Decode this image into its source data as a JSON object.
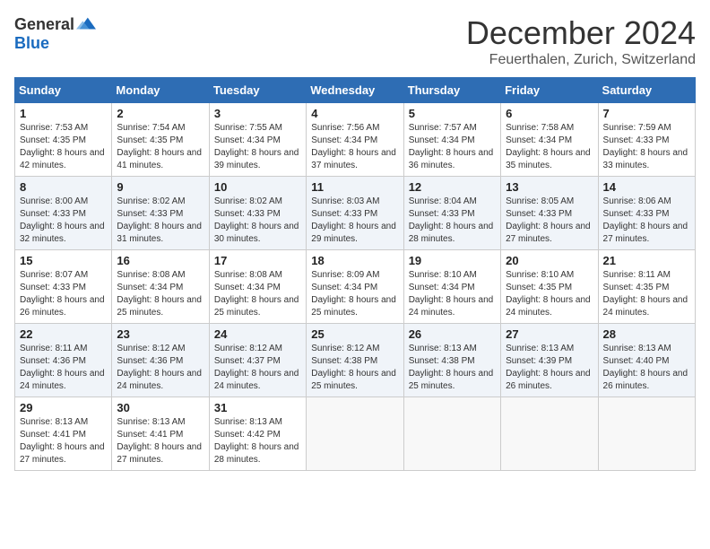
{
  "header": {
    "logo_general": "General",
    "logo_blue": "Blue",
    "month": "December 2024",
    "location": "Feuerthalen, Zurich, Switzerland"
  },
  "days_of_week": [
    "Sunday",
    "Monday",
    "Tuesday",
    "Wednesday",
    "Thursday",
    "Friday",
    "Saturday"
  ],
  "weeks": [
    [
      {
        "day": "1",
        "sunrise": "7:53 AM",
        "sunset": "4:35 PM",
        "daylight": "8 hours and 42 minutes."
      },
      {
        "day": "2",
        "sunrise": "7:54 AM",
        "sunset": "4:35 PM",
        "daylight": "8 hours and 41 minutes."
      },
      {
        "day": "3",
        "sunrise": "7:55 AM",
        "sunset": "4:34 PM",
        "daylight": "8 hours and 39 minutes."
      },
      {
        "day": "4",
        "sunrise": "7:56 AM",
        "sunset": "4:34 PM",
        "daylight": "8 hours and 37 minutes."
      },
      {
        "day": "5",
        "sunrise": "7:57 AM",
        "sunset": "4:34 PM",
        "daylight": "8 hours and 36 minutes."
      },
      {
        "day": "6",
        "sunrise": "7:58 AM",
        "sunset": "4:34 PM",
        "daylight": "8 hours and 35 minutes."
      },
      {
        "day": "7",
        "sunrise": "7:59 AM",
        "sunset": "4:33 PM",
        "daylight": "8 hours and 33 minutes."
      }
    ],
    [
      {
        "day": "8",
        "sunrise": "8:00 AM",
        "sunset": "4:33 PM",
        "daylight": "8 hours and 32 minutes."
      },
      {
        "day": "9",
        "sunrise": "8:02 AM",
        "sunset": "4:33 PM",
        "daylight": "8 hours and 31 minutes."
      },
      {
        "day": "10",
        "sunrise": "8:02 AM",
        "sunset": "4:33 PM",
        "daylight": "8 hours and 30 minutes."
      },
      {
        "day": "11",
        "sunrise": "8:03 AM",
        "sunset": "4:33 PM",
        "daylight": "8 hours and 29 minutes."
      },
      {
        "day": "12",
        "sunrise": "8:04 AM",
        "sunset": "4:33 PM",
        "daylight": "8 hours and 28 minutes."
      },
      {
        "day": "13",
        "sunrise": "8:05 AM",
        "sunset": "4:33 PM",
        "daylight": "8 hours and 27 minutes."
      },
      {
        "day": "14",
        "sunrise": "8:06 AM",
        "sunset": "4:33 PM",
        "daylight": "8 hours and 27 minutes."
      }
    ],
    [
      {
        "day": "15",
        "sunrise": "8:07 AM",
        "sunset": "4:33 PM",
        "daylight": "8 hours and 26 minutes."
      },
      {
        "day": "16",
        "sunrise": "8:08 AM",
        "sunset": "4:34 PM",
        "daylight": "8 hours and 25 minutes."
      },
      {
        "day": "17",
        "sunrise": "8:08 AM",
        "sunset": "4:34 PM",
        "daylight": "8 hours and 25 minutes."
      },
      {
        "day": "18",
        "sunrise": "8:09 AM",
        "sunset": "4:34 PM",
        "daylight": "8 hours and 25 minutes."
      },
      {
        "day": "19",
        "sunrise": "8:10 AM",
        "sunset": "4:34 PM",
        "daylight": "8 hours and 24 minutes."
      },
      {
        "day": "20",
        "sunrise": "8:10 AM",
        "sunset": "4:35 PM",
        "daylight": "8 hours and 24 minutes."
      },
      {
        "day": "21",
        "sunrise": "8:11 AM",
        "sunset": "4:35 PM",
        "daylight": "8 hours and 24 minutes."
      }
    ],
    [
      {
        "day": "22",
        "sunrise": "8:11 AM",
        "sunset": "4:36 PM",
        "daylight": "8 hours and 24 minutes."
      },
      {
        "day": "23",
        "sunrise": "8:12 AM",
        "sunset": "4:36 PM",
        "daylight": "8 hours and 24 minutes."
      },
      {
        "day": "24",
        "sunrise": "8:12 AM",
        "sunset": "4:37 PM",
        "daylight": "8 hours and 24 minutes."
      },
      {
        "day": "25",
        "sunrise": "8:12 AM",
        "sunset": "4:38 PM",
        "daylight": "8 hours and 25 minutes."
      },
      {
        "day": "26",
        "sunrise": "8:13 AM",
        "sunset": "4:38 PM",
        "daylight": "8 hours and 25 minutes."
      },
      {
        "day": "27",
        "sunrise": "8:13 AM",
        "sunset": "4:39 PM",
        "daylight": "8 hours and 26 minutes."
      },
      {
        "day": "28",
        "sunrise": "8:13 AM",
        "sunset": "4:40 PM",
        "daylight": "8 hours and 26 minutes."
      }
    ],
    [
      {
        "day": "29",
        "sunrise": "8:13 AM",
        "sunset": "4:41 PM",
        "daylight": "8 hours and 27 minutes."
      },
      {
        "day": "30",
        "sunrise": "8:13 AM",
        "sunset": "4:41 PM",
        "daylight": "8 hours and 27 minutes."
      },
      {
        "day": "31",
        "sunrise": "8:13 AM",
        "sunset": "4:42 PM",
        "daylight": "8 hours and 28 minutes."
      },
      null,
      null,
      null,
      null
    ]
  ],
  "labels": {
    "sunrise": "Sunrise:",
    "sunset": "Sunset:",
    "daylight": "Daylight:"
  }
}
